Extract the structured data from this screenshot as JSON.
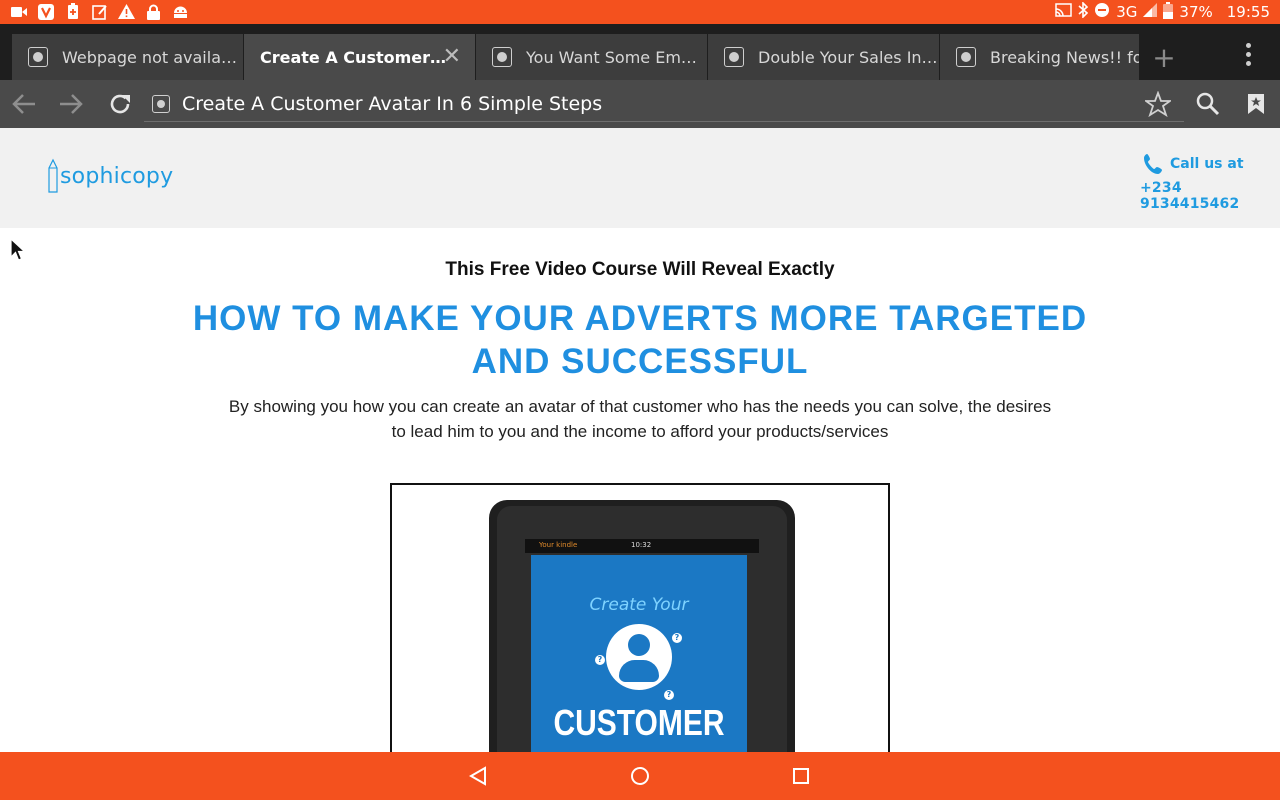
{
  "status_bar": {
    "battery": "37%",
    "time": "19:55",
    "network": "3G",
    "left_icons": [
      "video-icon",
      "vivaldi-icon",
      "battery-saver-icon",
      "edit-icon",
      "warning-icon",
      "lock-icon",
      "android-icon"
    ],
    "right_icons": [
      "cast-icon",
      "bluetooth-icon",
      "dnd-icon",
      "signal-icon",
      "battery-icon"
    ]
  },
  "tabs": [
    {
      "label": "Webpage not availa…",
      "active": false
    },
    {
      "label": "Create A Customer…",
      "active": true
    },
    {
      "label": "You Want Some Em…",
      "active": false
    },
    {
      "label": "Double Your Sales In…",
      "active": false
    },
    {
      "label": "Breaking News!! for",
      "active": false
    }
  ],
  "toolbar": {
    "url_title": "Create A Customer Avatar In 6 Simple Steps"
  },
  "site": {
    "logo_text": "sophicopy",
    "call_label": "Call us at",
    "phone": "+234 9134415462"
  },
  "content": {
    "kicker": "This Free Video Course Will Reveal Exactly",
    "headline_line1": "HOW TO MAKE YOUR ADVERTS MORE TARGETED",
    "headline_line2": "AND SUCCESSFUL",
    "description": "By showing you how you can create an avatar of that customer who has the needs you can solve, the desires to lead him to you and the income to afford your products/services"
  },
  "device_mockup": {
    "status_brand": "Your kindle",
    "status_time": "10:32",
    "screen_title": "Create Your",
    "screen_big": "CUSTOMER"
  },
  "colors": {
    "android_orange": "#f4511e",
    "brand_blue": "#1f9be0",
    "headline_blue": "#1f8fe0"
  }
}
